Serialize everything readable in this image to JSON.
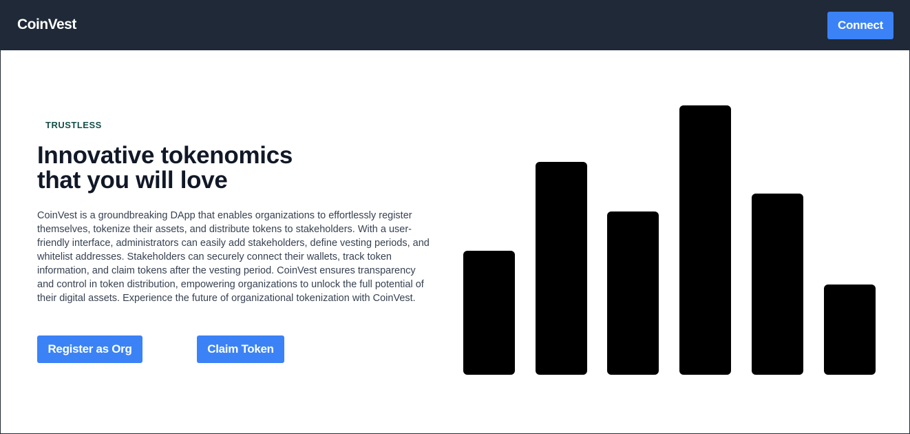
{
  "navbar": {
    "brand": "CoinVest",
    "connect_label": "Connect"
  },
  "hero": {
    "eyebrow": "TRUSTLESS",
    "headline_line1": "Innovative tokenomics",
    "headline_line2": "that you will love",
    "description": "CoinVest is a groundbreaking DApp that enables organizations to effortlessly register themselves, tokenize their assets, and distribute tokens to stakeholders. With a user-friendly interface, administrators can easily add stakeholders, define vesting periods, and whitelist addresses. Stakeholders can securely connect their wallets, track token information, and claim tokens after the vesting period. CoinVest ensures transparency and control in token distribution, empowering organizations to unlock the full potential of their digital assets. Experience the future of organizational tokenization with CoinVest.",
    "register_label": "Register as Org",
    "claim_label": "Claim Token"
  },
  "colors": {
    "navbar_bg": "#1f2937",
    "accent": "#3b82f6",
    "bar_color": "#000000"
  },
  "decorative_bars": {
    "relative_heights": [
      0.46,
      0.79,
      0.607,
      1.0,
      0.672,
      0.336
    ]
  }
}
